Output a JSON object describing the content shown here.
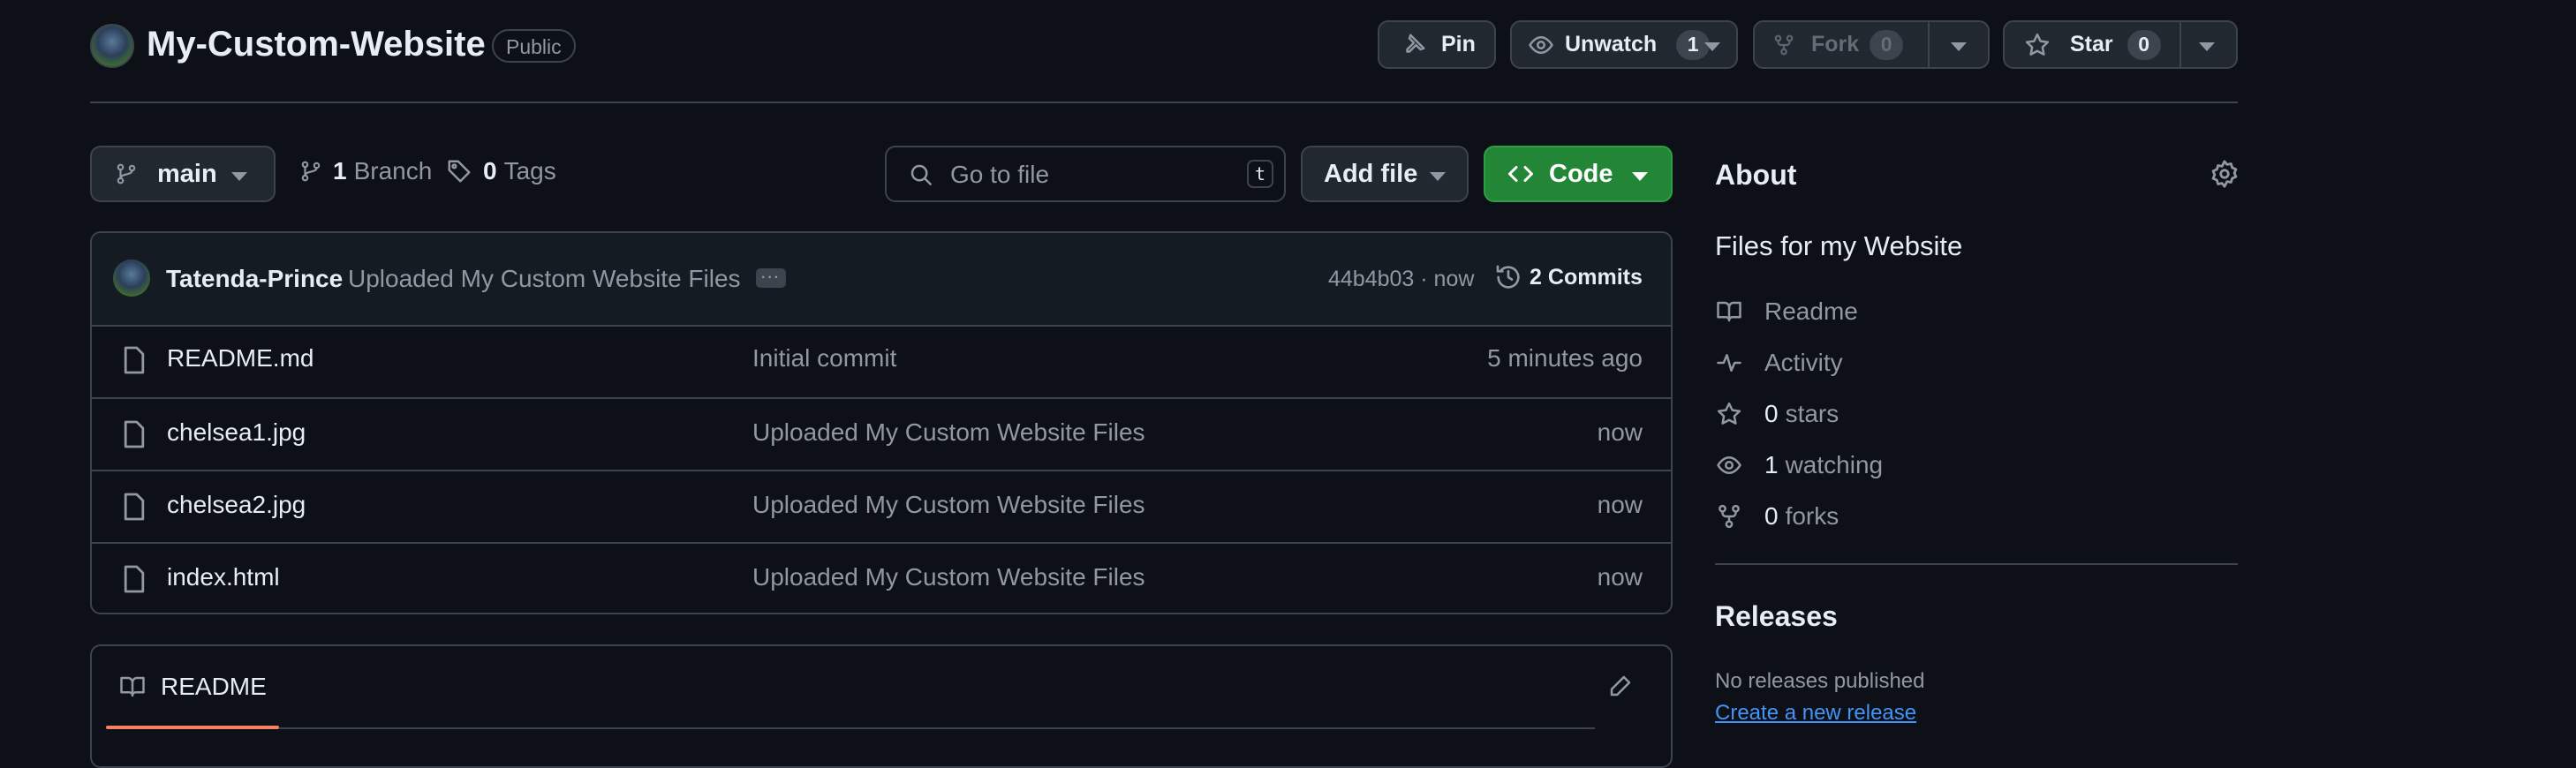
{
  "repo": {
    "name": "My-Custom-Website",
    "visibility": "Public"
  },
  "header_actions": {
    "pin_label": "Pin",
    "unwatch_label": "Unwatch",
    "watch_count": "1",
    "fork_label": "Fork",
    "fork_count": "0",
    "star_label": "Star",
    "star_count": "0"
  },
  "toolbar": {
    "branch": "main",
    "branch_count": "1",
    "branch_word": "Branch",
    "tag_count": "0",
    "tag_word": "Tags",
    "search_placeholder": "Go to file",
    "search_shortcut": "t",
    "add_file_label": "Add file",
    "code_label": "Code"
  },
  "latest_commit": {
    "author": "Tatenda-Prince",
    "message": "Uploaded My Custom Website Files",
    "hash_time": "44b4b03 · now",
    "commits_count": "2",
    "commits_word": "Commits"
  },
  "files": [
    {
      "name": "README.md",
      "message": "Initial commit",
      "time": "5 minutes ago"
    },
    {
      "name": "chelsea1.jpg",
      "message": "Uploaded My Custom Website Files",
      "time": "now"
    },
    {
      "name": "chelsea2.jpg",
      "message": "Uploaded My Custom Website Files",
      "time": "now"
    },
    {
      "name": "index.html",
      "message": "Uploaded My Custom Website Files",
      "time": "now"
    }
  ],
  "readme": {
    "tab_label": "README"
  },
  "about": {
    "heading": "About",
    "description": "Files for my Website",
    "readme_link": "Readme",
    "activity_link": "Activity",
    "stars_count": "0",
    "stars_word": "stars",
    "watching_count": "1",
    "watching_word": "watching",
    "forks_count": "0",
    "forks_word": "forks"
  },
  "releases": {
    "heading": "Releases",
    "none_text": "No releases published",
    "create_link": "Create a new release"
  },
  "colors": {
    "background": "#0d1117",
    "code_button": "#238636",
    "link": "#4493f8",
    "readme_underline": "#f78166"
  }
}
